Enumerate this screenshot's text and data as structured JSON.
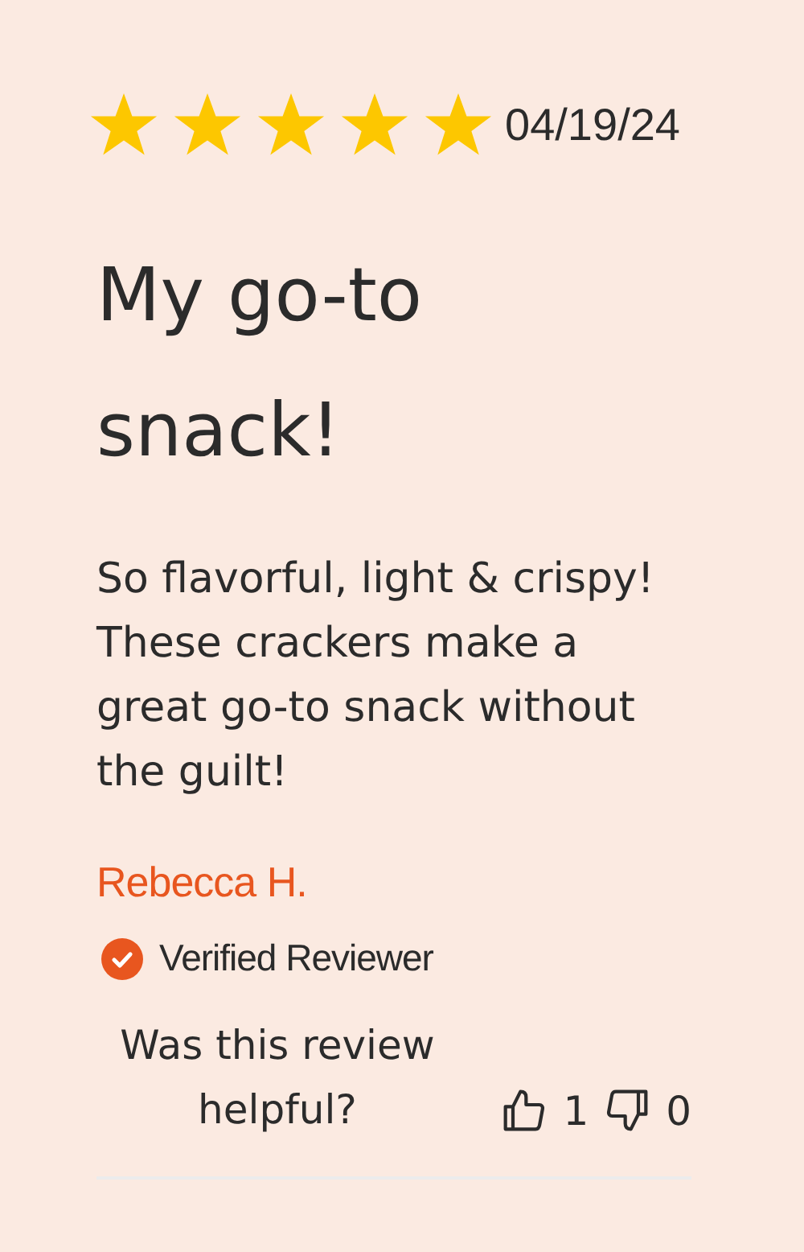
{
  "review": {
    "stars": 5,
    "date": "04/19/24",
    "title": "My go-to snack!",
    "body": "So flavorful, light & crispy! These crackers make a great go-to snack without the guilt!",
    "author": "Rebecca H.",
    "verified": true,
    "verified_label": "Verified Reviewer"
  },
  "helpful": {
    "question": "Was this review helpful?",
    "up_count": "1",
    "down_count": "0"
  }
}
